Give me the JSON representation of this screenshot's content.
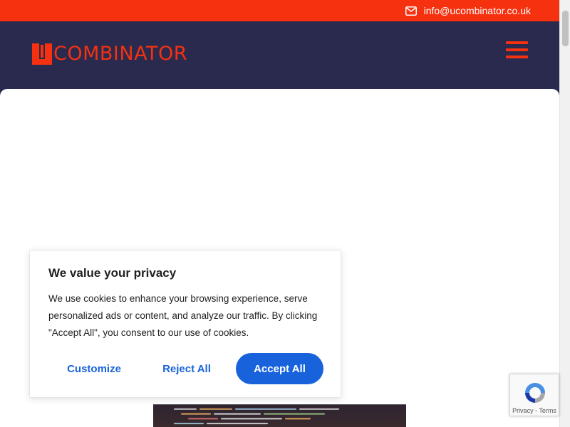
{
  "topbar": {
    "email": "info@ucombinator.co.uk",
    "icon": "envelope-icon"
  },
  "header": {
    "logo_text": "COMBINATOR",
    "menu_icon": "hamburger-icon"
  },
  "cookie_banner": {
    "title": "We value your privacy",
    "body": "We use cookies to enhance your browsing experience, serve personalized ads or content, and analyze our traffic. By clicking \"Accept All\", you consent to our use of cookies.",
    "customize_label": "Customize",
    "reject_label": "Reject All",
    "accept_label": "Accept All"
  },
  "recaptcha": {
    "privacy": "Privacy",
    "separator": " - ",
    "terms": "Terms"
  },
  "colors": {
    "brand_red": "#f5310f",
    "navy": "#2a2a4f",
    "accent_blue": "#1863dc"
  }
}
